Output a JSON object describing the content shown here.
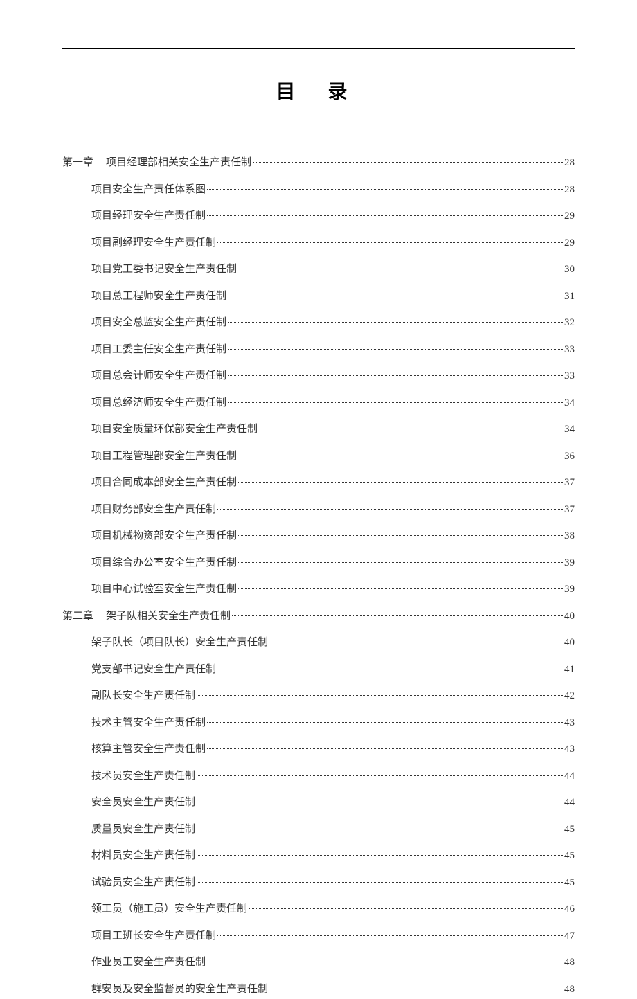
{
  "title": "目 录",
  "toc": [
    {
      "type": "chapter",
      "prefix": "第一章",
      "label": "项目经理部相关安全生产责任制",
      "page": "28"
    },
    {
      "type": "item",
      "label": "项目安全生产责任体系图",
      "page": "28"
    },
    {
      "type": "item",
      "label": "项目经理安全生产责任制",
      "page": "29"
    },
    {
      "type": "item",
      "label": "项目副经理安全生产责任制",
      "page": "29"
    },
    {
      "type": "item",
      "label": "项目党工委书记安全生产责任制",
      "page": "30"
    },
    {
      "type": "item",
      "label": "项目总工程师安全生产责任制",
      "page": "31"
    },
    {
      "type": "item",
      "label": "项目安全总监安全生产责任制",
      "page": "32"
    },
    {
      "type": "item",
      "label": "项目工委主任安全生产责任制",
      "page": "33"
    },
    {
      "type": "item",
      "label": "项目总会计师安全生产责任制",
      "page": "33"
    },
    {
      "type": "item",
      "label": "项目总经济师安全生产责任制",
      "page": "34"
    },
    {
      "type": "item",
      "label": "项目安全质量环保部安全生产责任制",
      "page": "34"
    },
    {
      "type": "item",
      "label": "项目工程管理部安全生产责任制",
      "page": "36"
    },
    {
      "type": "item",
      "label": "项目合同成本部安全生产责任制",
      "page": "37"
    },
    {
      "type": "item",
      "label": "项目财务部安全生产责任制",
      "page": "37"
    },
    {
      "type": "item",
      "label": "项目机械物资部安全生产责任制",
      "page": "38"
    },
    {
      "type": "item",
      "label": "项目综合办公室安全生产责任制",
      "page": "39"
    },
    {
      "type": "item",
      "label": "项目中心试验室安全生产责任制",
      "page": "39"
    },
    {
      "type": "chapter",
      "prefix": "第二章",
      "label": "架子队相关安全生产责任制",
      "page": "40"
    },
    {
      "type": "item",
      "label": "架子队长（项目队长）安全生产责任制",
      "page": "40"
    },
    {
      "type": "item",
      "label": "党支部书记安全生产责任制",
      "page": "41"
    },
    {
      "type": "item",
      "label": "副队长安全生产责任制",
      "page": "42"
    },
    {
      "type": "item",
      "label": "技术主管安全生产责任制",
      "page": "43"
    },
    {
      "type": "item",
      "label": "核算主管安全生产责任制",
      "page": "43"
    },
    {
      "type": "item",
      "label": "技术员安全生产责任制",
      "page": "44"
    },
    {
      "type": "item",
      "label": "安全员安全生产责任制",
      "page": "44"
    },
    {
      "type": "item",
      "label": "质量员安全生产责任制",
      "page": "45"
    },
    {
      "type": "item",
      "label": "材料员安全生产责任制",
      "page": "45"
    },
    {
      "type": "item",
      "label": "试验员安全生产责任制",
      "page": "45"
    },
    {
      "type": "item",
      "label": "领工员（施工员）安全生产责任制",
      "page": "46"
    },
    {
      "type": "item",
      "label": "项目工班长安全生产责任制",
      "page": "47"
    },
    {
      "type": "item",
      "label": "作业员工安全生产责任制",
      "page": "48"
    },
    {
      "type": "item",
      "label": "群安员及安全监督员的安全生产责任制",
      "page": "48"
    }
  ]
}
